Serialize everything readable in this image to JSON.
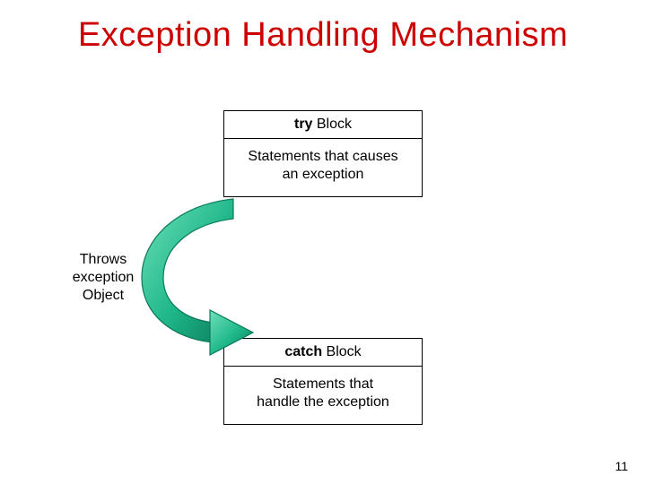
{
  "title": "Exception Handling Mechanism",
  "try_box": {
    "header_bold": "try",
    "header_rest": " Block",
    "body_line1": "Statements that causes",
    "body_line2": "an exception"
  },
  "catch_box": {
    "header_bold": "catch",
    "header_rest": " Block",
    "body_line1": "Statements that",
    "body_line2": "handle the exception"
  },
  "throws_label": {
    "line1": "Throws",
    "line2": "exception",
    "line3": "Object"
  },
  "page_number": "11",
  "colors": {
    "title": "#cc0000",
    "arrow_fill": "#1fb78a",
    "arrow_stroke": "#0a7a5a"
  }
}
